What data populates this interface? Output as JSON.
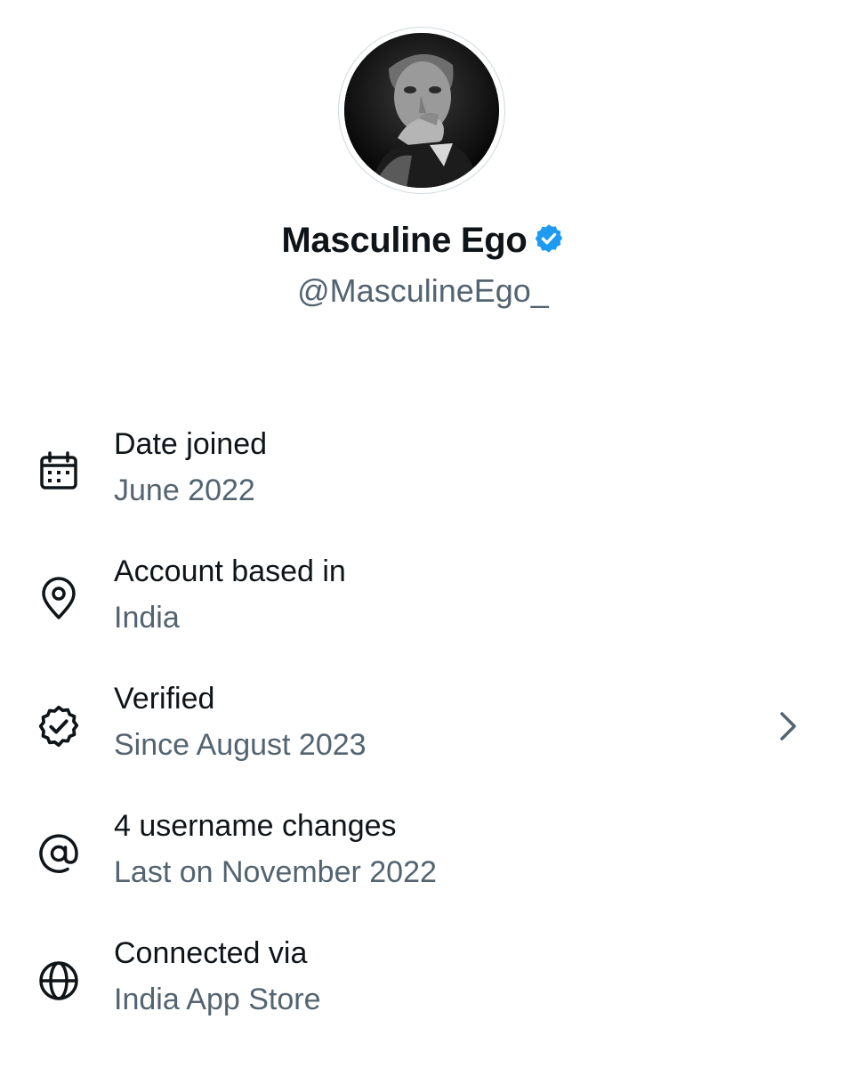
{
  "profile": {
    "display_name": "Masculine Ego",
    "handle": "@MasculineEgo_",
    "verified_badge_color": "#1d9bf0",
    "avatar_icon": "profile-photo-avatar"
  },
  "details": [
    {
      "icon": "calendar-icon",
      "title": "Date joined",
      "value": "June 2022"
    },
    {
      "icon": "location-pin-icon",
      "title": "Account based in",
      "value": "India"
    },
    {
      "icon": "verified-check-icon",
      "title": "Verified",
      "value": "Since August 2023",
      "has_chevron": true
    },
    {
      "icon": "at-sign-icon",
      "title": "4 username changes",
      "value": "Last on November 2022"
    },
    {
      "icon": "globe-icon",
      "title": "Connected via",
      "value": "India App Store"
    }
  ],
  "colors": {
    "primary_text": "#0f1419",
    "secondary_text": "#536471",
    "accent": "#1d9bf0"
  }
}
